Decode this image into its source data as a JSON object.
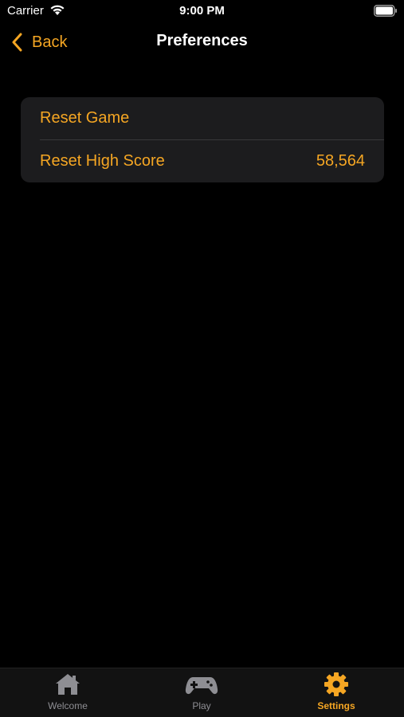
{
  "status_bar": {
    "carrier": "Carrier",
    "time": "9:00 PM"
  },
  "nav": {
    "back_label": "Back",
    "title": "Preferences"
  },
  "settings": {
    "rows": [
      {
        "label": "Reset Game",
        "value": ""
      },
      {
        "label": "Reset High Score",
        "value": "58,564"
      }
    ]
  },
  "tabs": [
    {
      "label": "Welcome",
      "icon": "house-icon",
      "selected": false
    },
    {
      "label": "Play",
      "icon": "gamecontroller-icon",
      "selected": false
    },
    {
      "label": "Settings",
      "icon": "gear-icon",
      "selected": true
    }
  ],
  "colors": {
    "accent": "#f5a623",
    "background": "#000000",
    "group_background": "#1c1c1e",
    "tab_inactive": "#8e8e93"
  }
}
